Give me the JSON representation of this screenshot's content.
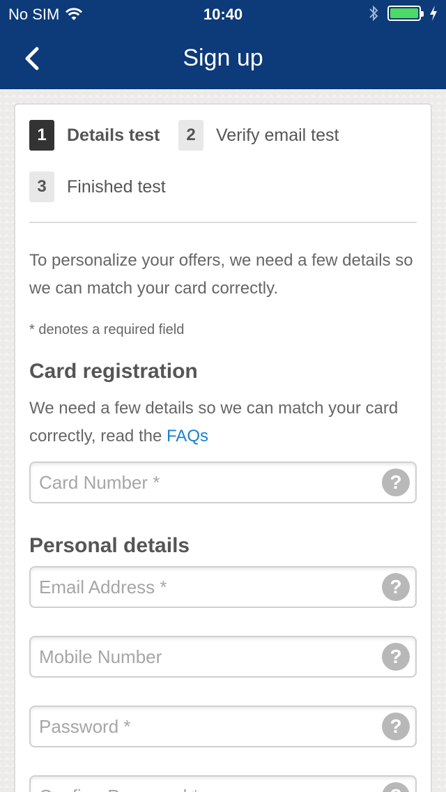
{
  "status_bar": {
    "carrier": "No SIM",
    "time": "10:40",
    "battery_color": "#4cd964"
  },
  "nav": {
    "title": "Sign up",
    "back_icon": "chevron-left-icon",
    "color": "#0d3a78"
  },
  "steps": [
    {
      "number": "1",
      "label": "Details test",
      "active": true
    },
    {
      "number": "2",
      "label": "Verify email test",
      "active": false
    },
    {
      "number": "3",
      "label": "Finished test",
      "active": false
    }
  ],
  "intro_text": "To personalize your offers, we need a few details so we can match your card correctly.",
  "required_note": "* denotes a required field",
  "card_registration": {
    "title": "Card registration",
    "desc_prefix": "We need a few details so we can match your card correctly, read the ",
    "faq_link": "FAQs"
  },
  "personal_details": {
    "title": "Personal details"
  },
  "fields": {
    "card_number": {
      "placeholder": "Card Number *",
      "value": ""
    },
    "email": {
      "placeholder": "Email Address *",
      "value": ""
    },
    "mobile": {
      "placeholder": "Mobile Number",
      "value": ""
    },
    "password": {
      "placeholder": "Password *",
      "value": ""
    },
    "confirm_password": {
      "placeholder": "Confirm Password *",
      "value": ""
    }
  },
  "help_glyph": "?",
  "link_color": "#1a7fd0"
}
